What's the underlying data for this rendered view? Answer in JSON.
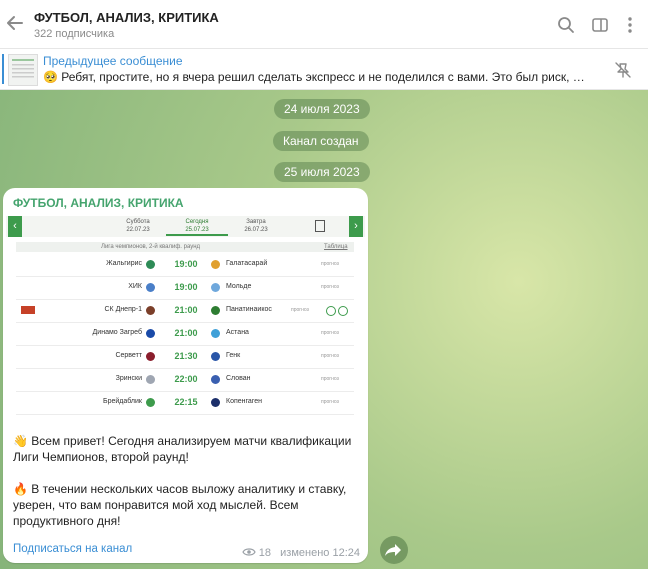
{
  "header": {
    "title": "ФУТБОЛ, АНАЛИЗ, КРИТИКА",
    "subscribers": "322 подписчика"
  },
  "pinned": {
    "title": "Предыдущее сообщение",
    "text": "🥺 Ребят, простите, но я вчера решил сделать экспресс и не поделился с вами. Это был риск, но он опр..."
  },
  "dates": {
    "d1": "24 июля 2023",
    "created": "Канал создан",
    "d2": "25 июля 2023"
  },
  "post": {
    "channel": "ФУТБОЛ, АНАЛИЗ, КРИТИКА",
    "p1": "👋 Всем привет! Сегодня анализируем матчи квалификации Лиги Чемпионов, второй раунд!",
    "p2": "🔥 В течении нескольких часов выложу аналитику и ставку, уверен, что вам понравится мой ход мыслей. Всем продуктивного дня!",
    "subscribe": "Подписаться на канал",
    "views": "18",
    "edited": "изменено 12:24"
  },
  "screenshot": {
    "days": [
      {
        "name": "Суббота",
        "date": "22.07.23"
      },
      {
        "name": "Сегодня",
        "date": "25.07.23"
      },
      {
        "name": "Завтра",
        "date": "26.07.23"
      }
    ],
    "league": "Лига чемпионов, 2-й квалиф. раунд",
    "table_link": "Таблица",
    "prognoz": "прогноз",
    "matches": [
      {
        "home": "Жальгирис",
        "time": "19:00",
        "away": "Галатасарай"
      },
      {
        "home": "ХИК",
        "time": "19:00",
        "away": "Мольде"
      },
      {
        "home": "СК Днепр-1",
        "time": "21:00",
        "away": "Панатинаикос"
      },
      {
        "home": "Динамо Загреб",
        "time": "21:00",
        "away": "Астана"
      },
      {
        "home": "Серветт",
        "time": "21:30",
        "away": "Генк"
      },
      {
        "home": "Зрински",
        "time": "22:00",
        "away": "Слован"
      },
      {
        "home": "Брейдаблик",
        "time": "22:15",
        "away": "Копенгаген"
      }
    ]
  },
  "colors": {
    "accent": "#3a8ed4",
    "channel_name": "#45a46e",
    "time_green": "#3d9b4c"
  }
}
